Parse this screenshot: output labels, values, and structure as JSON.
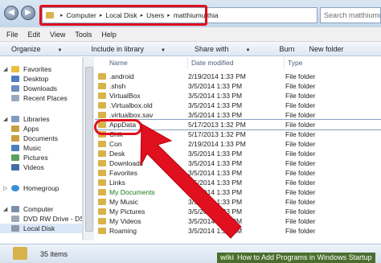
{
  "address": {
    "crumbs": [
      "Computer",
      "Local Disk",
      "Users",
      "matthiumutthia"
    ],
    "search_placeholder": "Search matthiumutthia"
  },
  "menu": [
    "File",
    "Edit",
    "View",
    "Tools",
    "Help"
  ],
  "commands": [
    "Organize",
    "Include in library",
    "Share with",
    "Burn",
    "New folder"
  ],
  "nav": {
    "favorites": "Favorites",
    "fav_items": [
      "Desktop",
      "Downloads",
      "Recent Places"
    ],
    "libraries": "Libraries",
    "lib_items": [
      "Apps",
      "Documents",
      "Music",
      "Pictures",
      "Videos"
    ],
    "homegroup": "Homegroup",
    "computer": "Computer",
    "comp_items": [
      "DVD RW Drive - DSTR",
      "Local Disk"
    ]
  },
  "columns": {
    "name": "Name",
    "date": "Date modified",
    "type": "Type"
  },
  "files": [
    {
      "name": ".android",
      "date": "2/19/2014 1:33 PM",
      "type": "File folder"
    },
    {
      "name": ".shsh",
      "date": "3/5/2014 1:33 PM",
      "type": "File folder"
    },
    {
      "name": "VirtualBox",
      "date": "3/5/2014 1:33 PM",
      "type": "File folder"
    },
    {
      "name": ".Virtualbox.old",
      "date": "3/5/2014 1:33 PM",
      "type": "File folder"
    },
    {
      "name": ".virtualbox.sav",
      "date": "3/5/2014 1:33 PM",
      "type": "File folder"
    },
    {
      "name": "AppData",
      "date": "5/17/2013 1:32 PM",
      "type": "File folder"
    },
    {
      "name": "Chik",
      "date": "5/17/2013 1:32 PM",
      "type": "File folder"
    },
    {
      "name": "Con",
      "date": "2/19/2014 1:33 PM",
      "type": "File folder"
    },
    {
      "name": "Desk",
      "date": "3/5/2014 1:33 PM",
      "type": "File folder"
    },
    {
      "name": "Downloads",
      "date": "3/5/2014 1:33 PM",
      "type": "File folder"
    },
    {
      "name": "Favorites",
      "date": "3/5/2014 1:33 PM",
      "type": "File folder"
    },
    {
      "name": "Links",
      "date": "3/5/2014 1:33 PM",
      "type": "File folder"
    },
    {
      "name": "My Documents",
      "date": "3/5/2014 1:33 PM",
      "type": "File folder"
    },
    {
      "name": "My Music",
      "date": "3/5/2014 1:33 PM",
      "type": "File folder"
    },
    {
      "name": "My Pictures",
      "date": "3/5/2014 1:33 PM",
      "type": "File folder"
    },
    {
      "name": "My Videos",
      "date": "3/5/2014 1:33 PM",
      "type": "File folder"
    },
    {
      "name": "Roaming",
      "date": "3/5/2014 1:33 PM",
      "type": "File folder"
    }
  ],
  "status": {
    "count": "35 items"
  },
  "watermark": {
    "brand": "wiki",
    "text": "How to Add Programs in Windows Startup"
  },
  "colors": {
    "highlight_red": "#e0101e",
    "folder": "#d8b24a"
  }
}
